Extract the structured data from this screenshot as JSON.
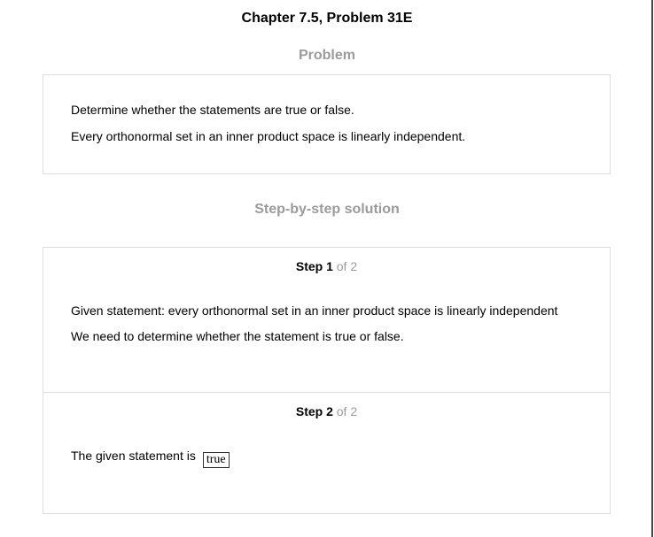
{
  "title": "Chapter 7.5, Problem 31E",
  "problem": {
    "heading": "Problem",
    "lines": [
      "Determine whether the statements are true or false.",
      "Every orthonormal set in an inner product space is linearly independent."
    ]
  },
  "solution": {
    "heading": "Step-by-step solution",
    "steps": [
      {
        "label": "Step 1",
        "of": "of 2",
        "lines": [
          "Given statement: every orthonormal set in an inner product space is linearly independent",
          "We need to determine whether the statement is true or false."
        ]
      },
      {
        "label": "Step 2",
        "of": "of 2",
        "text": "The given statement is",
        "answer": "true"
      }
    ]
  }
}
